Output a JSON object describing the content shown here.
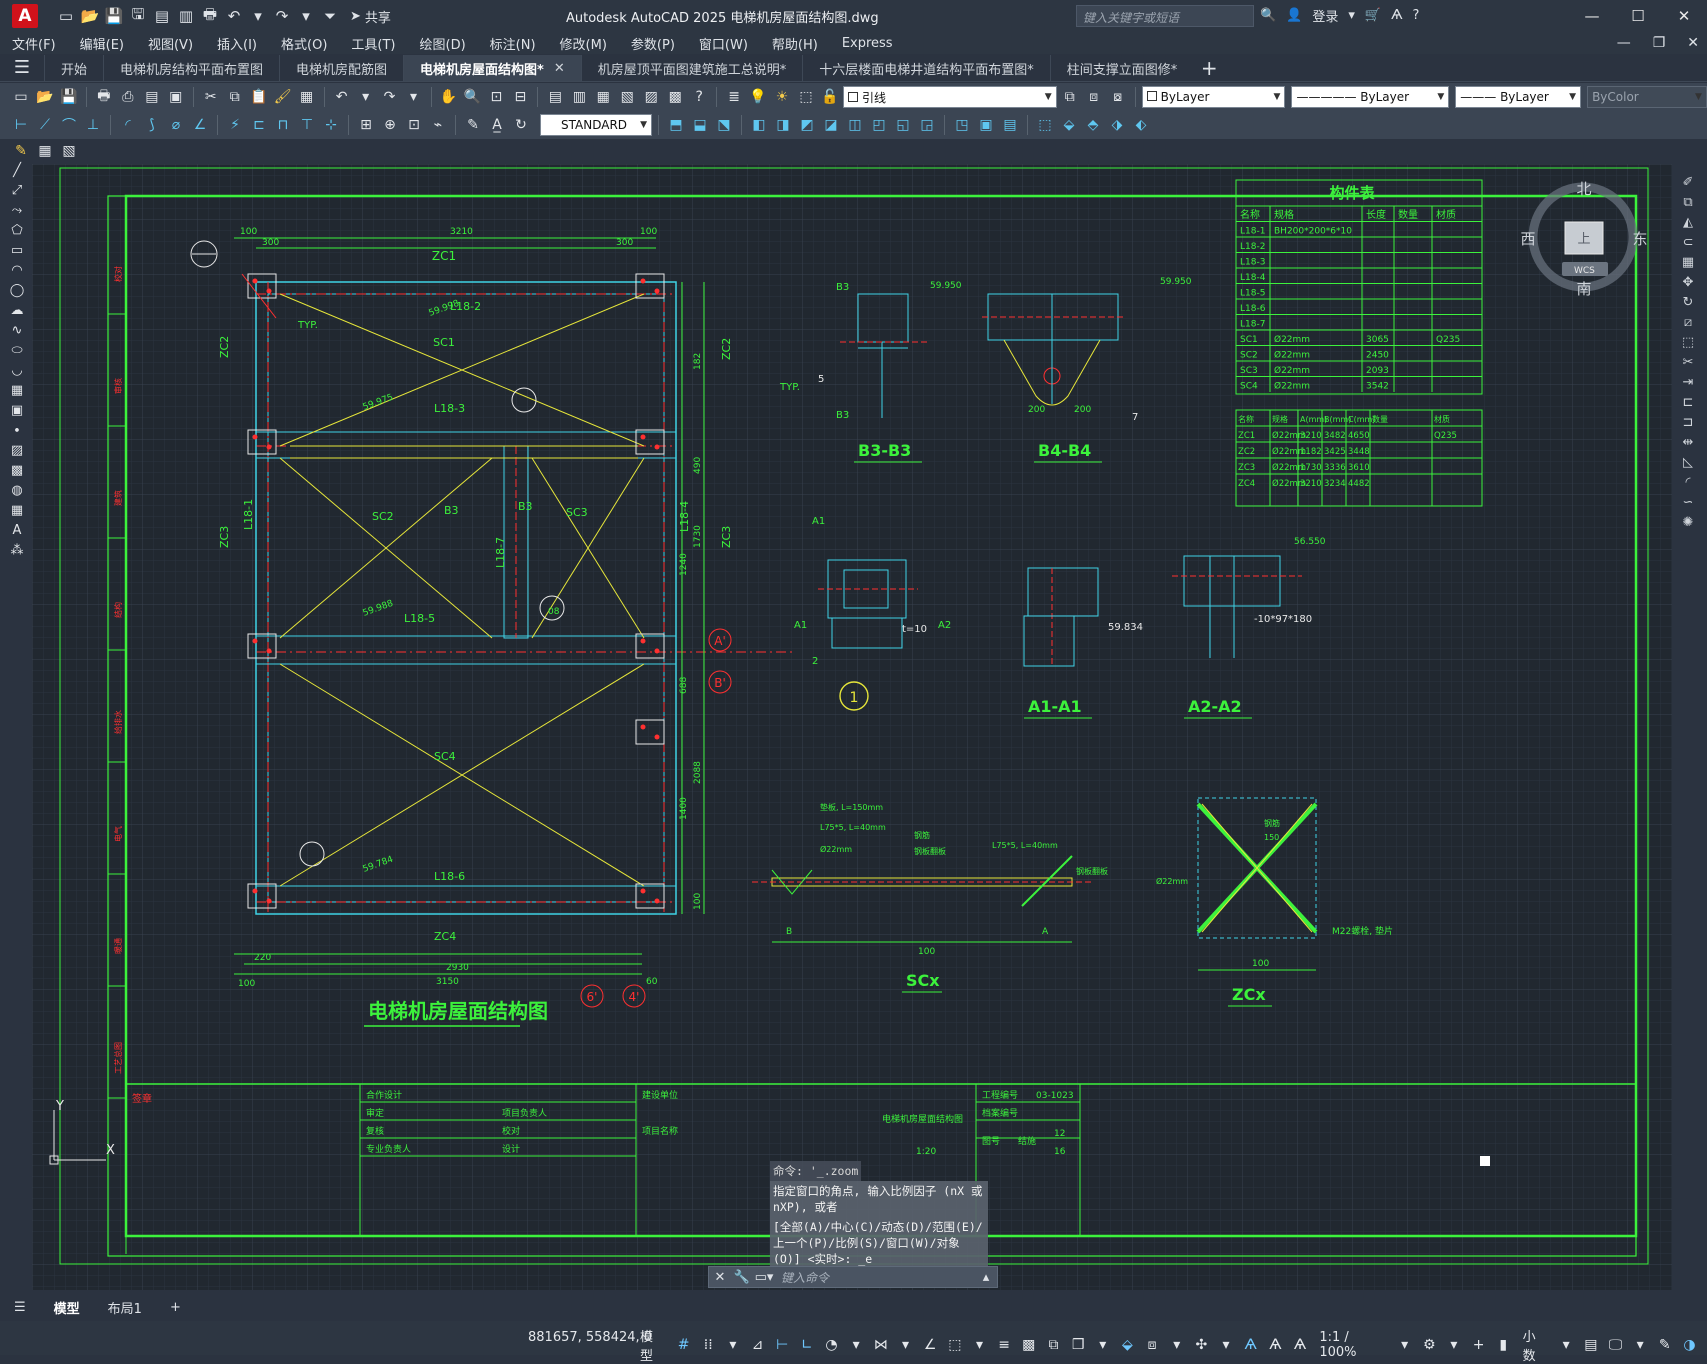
{
  "app": {
    "logo": "A",
    "window_title": "Autodesk AutoCAD 2025    电梯机房屋面结构图.dwg",
    "share": "共享",
    "search_placeholder": "键入关键字或短语",
    "login": "登录"
  },
  "menu": [
    "文件(F)",
    "编辑(E)",
    "视图(V)",
    "插入(I)",
    "格式(O)",
    "工具(T)",
    "绘图(D)",
    "标注(N)",
    "修改(M)",
    "参数(P)",
    "窗口(W)",
    "帮助(H)",
    "Express"
  ],
  "tabs": [
    {
      "label": "开始",
      "active": false
    },
    {
      "label": "电梯机房结构平面布置图",
      "active": false
    },
    {
      "label": "电梯机房配筋图",
      "active": false
    },
    {
      "label": "电梯机房屋面结构图*",
      "active": true
    },
    {
      "label": "机房屋顶平面图建筑施工总说明*",
      "active": false
    },
    {
      "label": "十六层楼面电梯井道结构平面布置图*",
      "active": false
    },
    {
      "label": "柱间支撑立面图修*",
      "active": false
    }
  ],
  "toolbar": {
    "leader_combo": "引线",
    "layer_color": "ByLayer",
    "linetype": "ByLayer",
    "lineweight": "ByLayer",
    "plot_style": "ByColor",
    "text_style": "STANDARD"
  },
  "viewcube": {
    "north": "北",
    "south": "南",
    "east": "东",
    "west": "西",
    "top": "上",
    "wcs": "WCS"
  },
  "drawing": {
    "main_title": "电梯机房屋面结构图",
    "dims_top": [
      "100",
      "300",
      "3210",
      "300",
      "100"
    ],
    "dims_bottom": [
      "100",
      "220",
      "2930",
      "3150",
      "60"
    ],
    "beams": [
      "ZC1",
      "L18-2",
      "SC1",
      "L18-3",
      "L18-1",
      "SC2",
      "L18-7",
      "SC3",
      "L18-4",
      "L18-5",
      "SC4",
      "L18-6",
      "ZC4",
      "ZC2",
      "ZC3"
    ],
    "dims_right": [
      "182",
      "490",
      "1730",
      "1240",
      "688",
      "2088",
      "1400",
      "100"
    ],
    "left_labels": [
      "ZC2",
      "ZC3"
    ],
    "typ": "TYP.",
    "angles": [
      "59.975",
      "59.988",
      "59.784",
      "59.998"
    ],
    "markers": [
      "1",
      "08",
      "A'",
      "B'",
      "6'",
      "4'"
    ],
    "section_labels": [
      "B3",
      "B3",
      "B4-B4",
      "B3-B3",
      "A1-A1",
      "A2-A2",
      "SCx",
      "ZCx"
    ],
    "detail_texts": [
      "59.950",
      "59.950",
      "TYP.",
      "7",
      "5",
      "A2",
      "A1",
      "A1",
      "A2",
      "2",
      "t=10",
      "-10*97*180",
      "59.834",
      "56.550",
      "M22螺栓, 垫片",
      "垫板, L=150mm",
      "L75*5, L=40mm",
      "Ø22mm",
      "钢筋",
      "钢板翻板",
      "L75*5, L=40mm",
      "钢板翻板",
      "Ø22mm",
      "钢筋",
      "150",
      "150",
      "B",
      "A",
      "200",
      "200",
      "100",
      "100"
    ]
  },
  "table1": {
    "title": "构件表",
    "headers": [
      "名称",
      "规格",
      "长度",
      "数量",
      "材质"
    ],
    "rows": [
      [
        "L18-1",
        "BH200*200*6*10",
        "",
        "",
        ""
      ],
      [
        "L18-2",
        "",
        "",
        "",
        ""
      ],
      [
        "L18-3",
        "",
        "",
        "",
        ""
      ],
      [
        "L18-4",
        "",
        "",
        "",
        ""
      ],
      [
        "L18-5",
        "",
        "",
        "",
        ""
      ],
      [
        "L18-6",
        "",
        "",
        "",
        ""
      ],
      [
        "L18-7",
        "",
        "",
        "",
        ""
      ],
      [
        "SC1",
        "Ø22mm",
        "3065",
        "",
        "Q235"
      ],
      [
        "SC2",
        "Ø22mm",
        "2450",
        "",
        ""
      ],
      [
        "SC3",
        "Ø22mm",
        "2093",
        "",
        ""
      ],
      [
        "SC4",
        "Ø22mm",
        "3542",
        "",
        ""
      ]
    ],
    "material_top": "Q235"
  },
  "table2": {
    "headers": [
      "名称",
      "规格",
      "A(mm)",
      "B(mm)",
      "C(mm)",
      "数量",
      "材质"
    ],
    "rows": [
      [
        "ZC1",
        "Ø22mm",
        "3210",
        "3482",
        "4650",
        "",
        "Q235"
      ],
      [
        "ZC2",
        "Ø22mm",
        "1182",
        "3425",
        "3448",
        "",
        ""
      ],
      [
        "ZC3",
        "Ø22mm",
        "1730",
        "3336",
        "3610",
        "",
        ""
      ],
      [
        "ZC4",
        "Ø22mm",
        "3210",
        "3234",
        "4482",
        "",
        ""
      ]
    ]
  },
  "titleblock": {
    "sign": "签章",
    "rows": [
      "合作设计",
      "审定",
      "复核",
      "专业负责人"
    ],
    "mid": [
      "项目负责人",
      "校对",
      "设计"
    ],
    "build_unit": "建设单位",
    "project_name": "项目名称",
    "drawing_no_label": "工程编号",
    "drawing_no": "03-1023",
    "archive_label": "档案编号",
    "drawing_title": "电梯机房屋面结构图",
    "scale": "1:20",
    "sheet_label": "图号",
    "sheet_col": "结施",
    "sheet_no": "12",
    "sheet_total": "16"
  },
  "left_strip": [
    "校对",
    "审核",
    "建筑",
    "结构",
    "给排水",
    "电气",
    "暖通",
    "工艺总图"
  ],
  "command": {
    "line1": "命令: '_.zoom",
    "line2": "指定窗口的角点, 输入比例因子 (nX 或 nXP), 或者",
    "line3": "[全部(A)/中心(C)/动态(D)/范围(E)/上一个(P)/比例(S)/窗口(W)/对象(O)] <实时>: _e",
    "placeholder": "键入命令"
  },
  "layout": {
    "model": "模型",
    "layout1": "布局1"
  },
  "status": {
    "coords": "881657, 558424, 0",
    "model": "模型",
    "scale": "1:1 / 100%",
    "units": "小数"
  },
  "ucs": {
    "x": "X",
    "y": "Y"
  }
}
